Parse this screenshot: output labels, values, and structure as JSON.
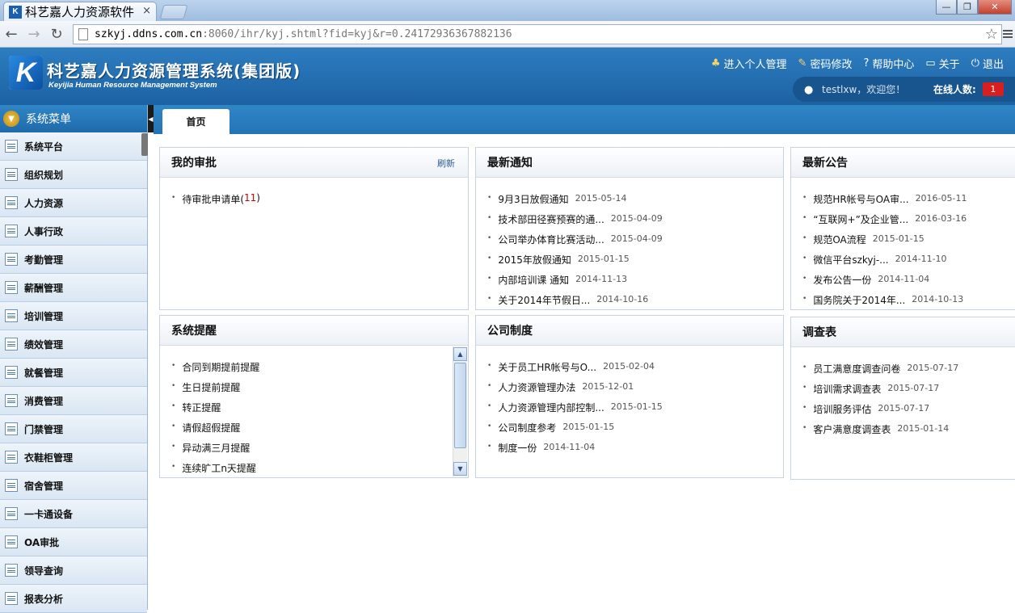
{
  "browser": {
    "tab_title": "科艺嘉人力资源软件",
    "tab_close": "×",
    "url_host": "szkyj.ddns.com.cn",
    "url_rest": ":8060/ihr/kyj.shtml?fid=kyj&r=0.24172936367882136",
    "window_buttons": [
      "—",
      "❐",
      "✕"
    ]
  },
  "header": {
    "logo_letter": "K",
    "title": "科艺嘉人力资源管理系统(集团版)",
    "subtitle": "Keyijia Human Resource Management System",
    "links": [
      {
        "icon": "person-icon",
        "label": "进入个人管理"
      },
      {
        "icon": "pencil-icon",
        "label": "密码修改"
      },
      {
        "icon": "help-icon",
        "label": "帮助中心"
      },
      {
        "icon": "chat-icon",
        "label": "关于"
      },
      {
        "icon": "power-icon",
        "label": "退出"
      }
    ],
    "welcome": "testlxw，欢迎您！",
    "online_label": "在线人数:",
    "online_count": "1"
  },
  "sidebar": {
    "title": "系统菜单",
    "items": [
      "系统平台",
      "组织规划",
      "人力资源",
      "人事行政",
      "考勤管理",
      "薪酬管理",
      "培训管理",
      "绩效管理",
      "就餐管理",
      "消费管理",
      "门禁管理",
      "衣鞋柜管理",
      "宿舍管理",
      "一卡通设备",
      "OA审批",
      "领导查询",
      "报表分析"
    ]
  },
  "tabs": {
    "home": "首页"
  },
  "panels": {
    "approvals": {
      "title": "我的审批",
      "refresh": "刷新",
      "item_label": "待审批申请单(",
      "item_count": "11",
      "item_close": ")"
    },
    "notices": {
      "title": "最新通知",
      "items": [
        {
          "text": "9月3日放假通知",
          "date": "2015-05-14"
        },
        {
          "text": "技术部田径赛预赛的通...",
          "date": "2015-04-09"
        },
        {
          "text": "公司举办体育比赛活动...",
          "date": "2015-04-09"
        },
        {
          "text": "2015年放假通知",
          "date": "2015-01-15"
        },
        {
          "text": "内部培训课 通知",
          "date": "2014-11-13"
        },
        {
          "text": "关于2014年节假日...",
          "date": "2014-10-16"
        }
      ]
    },
    "announcements": {
      "title": "最新公告",
      "items": [
        {
          "text": "规范HR帐号与OA审...",
          "date": "2016-05-11"
        },
        {
          "text": "“互联网+”及企业管...",
          "date": "2016-03-16"
        },
        {
          "text": "规范OA流程",
          "date": "2015-01-15"
        },
        {
          "text": "微信平台szkyj-...",
          "date": "2014-11-10"
        },
        {
          "text": "发布公告一份",
          "date": "2014-11-04"
        },
        {
          "text": "国务院关于2014年...",
          "date": "2014-10-13"
        }
      ]
    },
    "reminders": {
      "title": "系统提醒",
      "items": [
        "合同到期提前提醒",
        "生日提前提醒",
        "转正提醒",
        "请假超假提醒",
        "异动满三月提醒",
        "连续旷工n天提醒"
      ]
    },
    "policies": {
      "title": "公司制度",
      "items": [
        {
          "text": "关于员工HR帐号与O...",
          "date": "2015-02-04"
        },
        {
          "text": "人力资源管理办法",
          "date": "2015-12-01"
        },
        {
          "text": "人力资源管理内部控制...",
          "date": "2015-01-15"
        },
        {
          "text": "公司制度参考",
          "date": "2015-01-15"
        },
        {
          "text": "制度一份",
          "date": "2014-11-04"
        }
      ]
    },
    "surveys": {
      "title": "调查表",
      "items": [
        {
          "text": "员工满意度调查问卷",
          "date": "2015-07-17"
        },
        {
          "text": "培训需求调查表",
          "date": "2015-07-17"
        },
        {
          "text": "培训服务评估",
          "date": "2015-07-17"
        },
        {
          "text": "客户满意度调查表",
          "date": "2015-01-14"
        }
      ]
    }
  }
}
